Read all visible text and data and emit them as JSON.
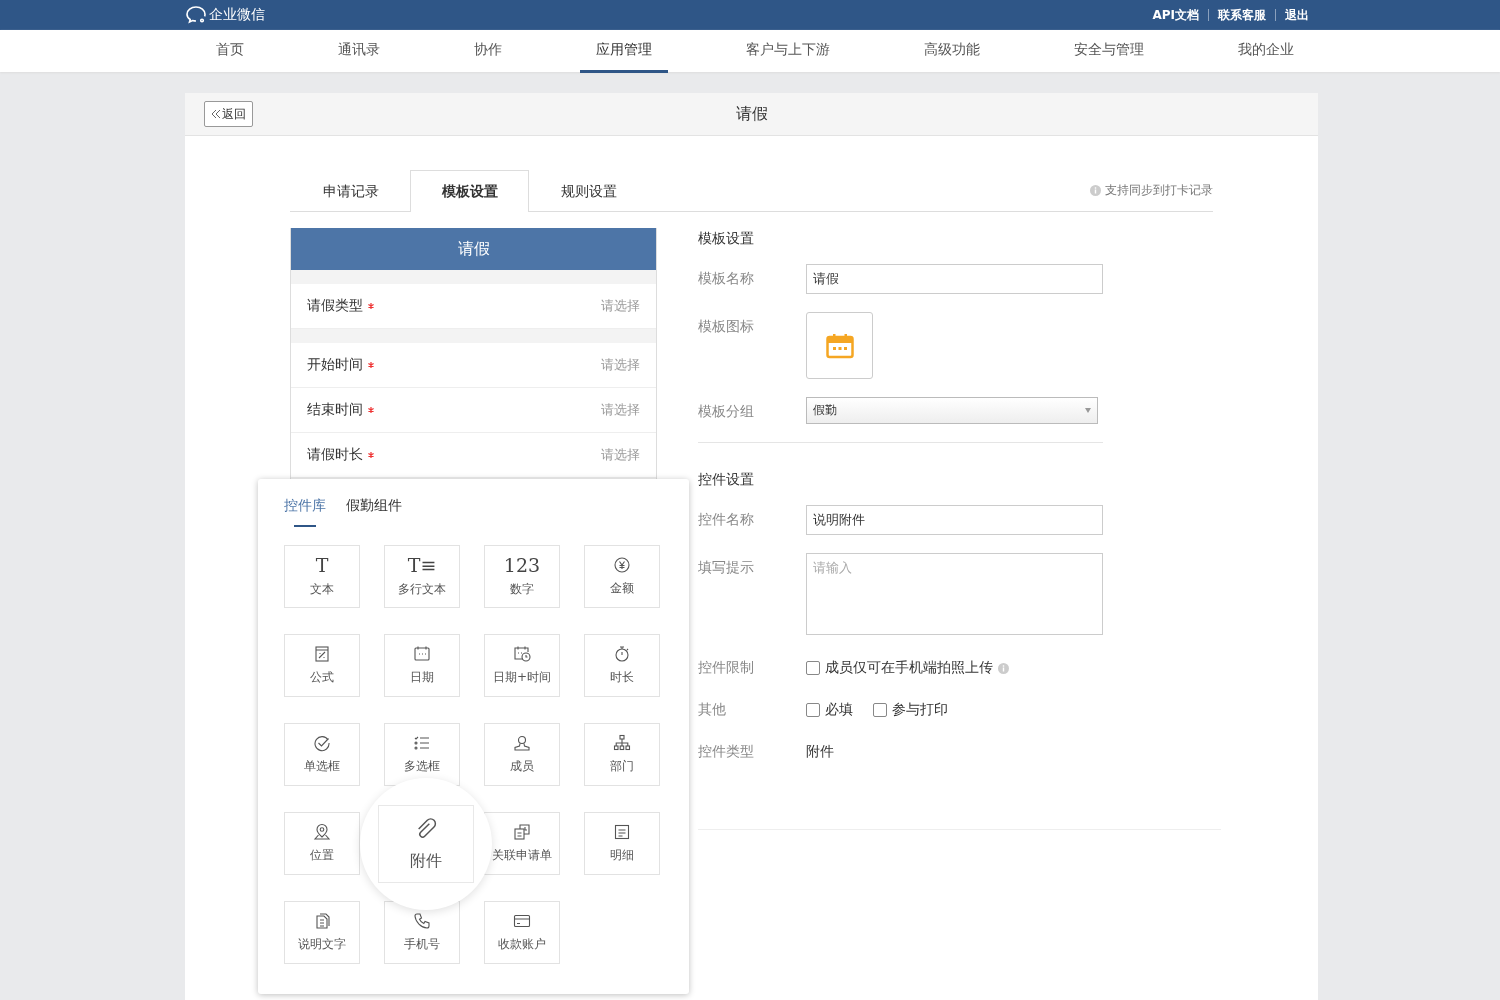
{
  "top_bar": {
    "logo": "企业微信",
    "links": [
      "API文档",
      "联系客服",
      "退出"
    ]
  },
  "nav": [
    {
      "label": "首页",
      "selected": false
    },
    {
      "label": "通讯录",
      "selected": false
    },
    {
      "label": "协作",
      "selected": false
    },
    {
      "label": "应用管理",
      "selected": true
    },
    {
      "label": "客户与上下游",
      "selected": false
    },
    {
      "label": "高级功能",
      "selected": false
    },
    {
      "label": "安全与管理",
      "selected": false
    },
    {
      "label": "我的企业",
      "selected": false
    }
  ],
  "page": {
    "back": "返回",
    "title": "请假"
  },
  "tabs": [
    {
      "label": "申请记录",
      "selected": false
    },
    {
      "label": "模板设置",
      "selected": true
    },
    {
      "label": "规则设置",
      "selected": false
    }
  ],
  "tab_hint": "支持同步到打卡记录",
  "preview": {
    "title": "请假",
    "sections": [
      [
        {
          "label": "请假类型",
          "required": true,
          "placeholder": "请选择"
        }
      ],
      [
        {
          "label": "开始时间",
          "required": true,
          "placeholder": "请选择"
        },
        {
          "label": "结束时间",
          "required": true,
          "placeholder": "请选择"
        },
        {
          "label": "请假时长",
          "required": true,
          "placeholder": "请选择"
        }
      ]
    ]
  },
  "palette": {
    "tabs": [
      {
        "label": "控件库",
        "selected": true
      },
      {
        "label": "假勤组件",
        "selected": false
      }
    ],
    "items": [
      {
        "label": "文本",
        "glyph": "T",
        "highlighted": false
      },
      {
        "label": "多行文本",
        "glyph": "T≡",
        "highlighted": false
      },
      {
        "label": "数字",
        "glyph": "123",
        "highlighted": false
      },
      {
        "label": "金额",
        "highlighted": false
      },
      {
        "label": "公式",
        "highlighted": false
      },
      {
        "label": "日期",
        "highlighted": false
      },
      {
        "label": "日期+时间",
        "highlighted": false
      },
      {
        "label": "时长",
        "highlighted": false
      },
      {
        "label": "单选框",
        "highlighted": false
      },
      {
        "label": "多选框",
        "highlighted": false
      },
      {
        "label": "成员",
        "highlighted": false
      },
      {
        "label": "部门",
        "highlighted": false
      },
      {
        "label": "位置",
        "highlighted": false
      },
      {
        "label": "附件",
        "highlighted": true
      },
      {
        "label": "关联申请单",
        "highlighted": false
      },
      {
        "label": "明细",
        "highlighted": false
      },
      {
        "label": "说明文字",
        "highlighted": false
      },
      {
        "label": "手机号",
        "highlighted": false
      },
      {
        "label": "收款账户",
        "highlighted": false
      }
    ]
  },
  "template_settings": {
    "heading": "模板设置",
    "fields": [
      {
        "kind": "input",
        "label": "模板名称",
        "value": "请假"
      },
      {
        "kind": "icon",
        "label": "模板图标"
      },
      {
        "kind": "select",
        "label": "模板分组",
        "value": "假勤"
      }
    ]
  },
  "control_settings": {
    "heading": "控件设置",
    "fields": [
      {
        "kind": "input",
        "label": "控件名称",
        "value": "说明附件"
      },
      {
        "kind": "textarea",
        "label": "填写提示",
        "placeholder": "请输入"
      },
      {
        "kind": "checks",
        "label": "控件限制",
        "options": [
          {
            "label": "成员仅可在手机端拍照上传",
            "checked": false,
            "info": true
          }
        ]
      },
      {
        "kind": "checks",
        "label": "其他",
        "options": [
          {
            "label": "必填",
            "checked": false,
            "info": false
          },
          {
            "label": "参与打印",
            "checked": false,
            "info": false
          }
        ]
      },
      {
        "kind": "text",
        "label": "控件类型",
        "value": "附件"
      }
    ]
  }
}
